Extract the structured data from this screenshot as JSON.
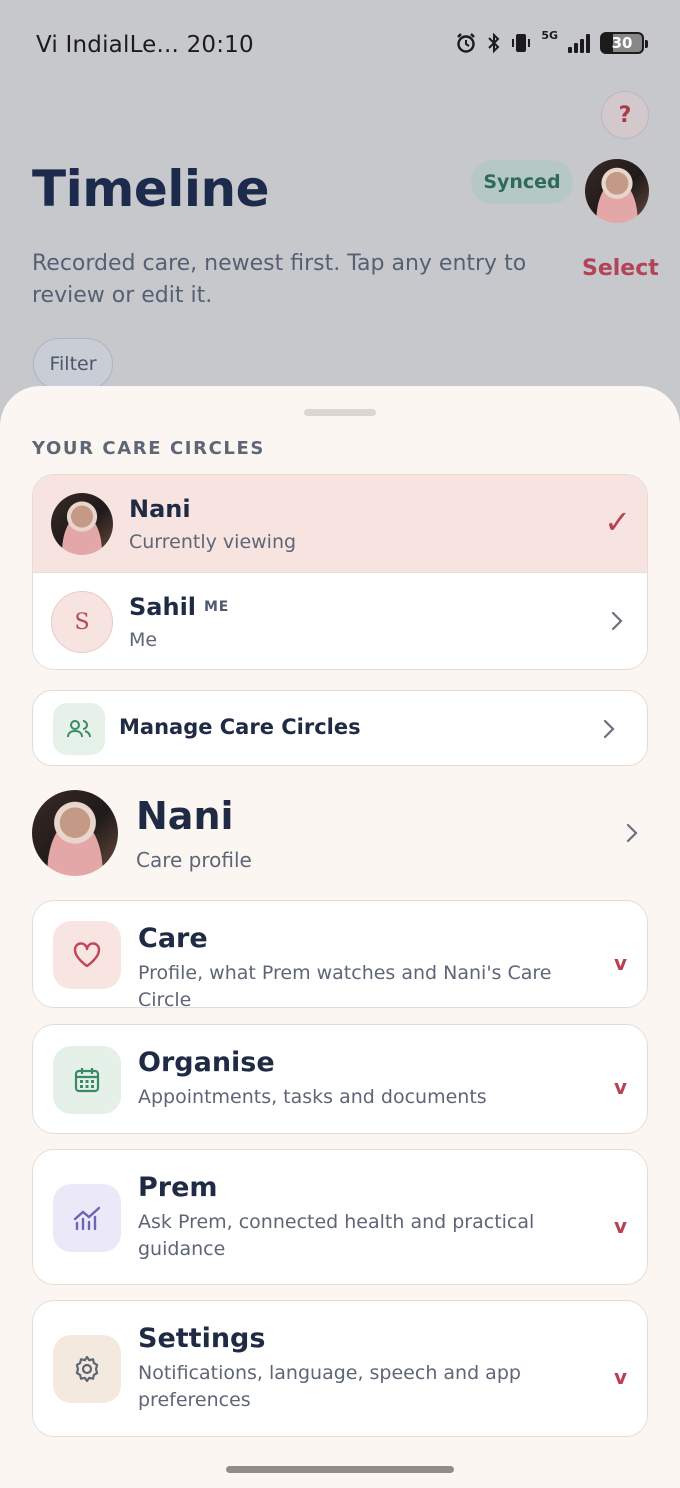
{
  "status_bar": {
    "carrier_time": "Vi IndialLe... 20:10",
    "network": "5G",
    "battery": "30"
  },
  "header": {
    "help_label": "?",
    "title": "Timeline",
    "sync_badge": "Synced",
    "subtitle": "Recorded care, newest first. Tap any entry to review or edit it.",
    "select_label": "Select",
    "filter_label": "Filter"
  },
  "sheet": {
    "section_label": "YOUR CARE CIRCLES",
    "circles": [
      {
        "name": "Nani",
        "sub": "Currently viewing",
        "check": "✓"
      },
      {
        "name": "Sahil",
        "tag": "ME",
        "sub": "Me",
        "initial": "S"
      }
    ],
    "manage_label": "Manage Care Circles",
    "profile": {
      "name": "Nani",
      "sub": "Care profile"
    },
    "cards": [
      {
        "title": "Care",
        "desc": "Profile, what Prem watches and Nani's Care Circle",
        "caret": "v"
      },
      {
        "title": "Organise",
        "desc": "Appointments, tasks and documents",
        "caret": "v"
      },
      {
        "title": "Prem",
        "desc": "Ask Prem, connected health and practical guidance",
        "caret": "v"
      },
      {
        "title": "Settings",
        "desc": "Notifications, language, speech and app preferences",
        "caret": "v"
      }
    ]
  },
  "colors": {
    "accent": "#b64354",
    "navy": "#1f2b45",
    "sheet_bg": "#fbf6f1",
    "dim_bg": "#c7c8cc"
  }
}
